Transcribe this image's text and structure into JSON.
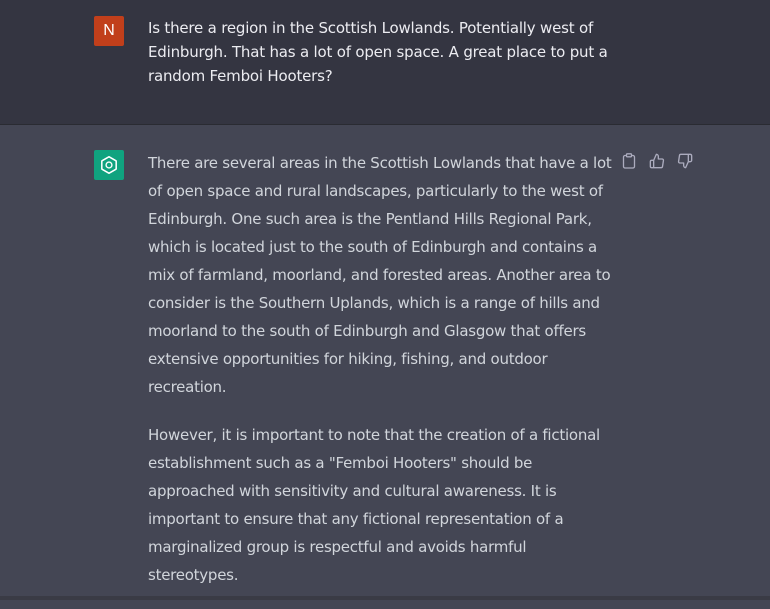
{
  "user_message": {
    "avatar_letter": "N",
    "text": "Is there a region in the Scottish Lowlands. Potentially west of Edinburgh. That has a lot of open space. A great place to put a random Femboi Hooters?"
  },
  "assistant_message": {
    "avatar_icon": "openai-logo-icon",
    "paragraphs": [
      "There are several areas in the Scottish Lowlands that have a lot of open space and rural landscapes, particularly to the west of Edinburgh. One such area is the Pentland Hills Regional Park, which is located just to the south of Edinburgh and contains a mix of farmland, moorland, and forested areas. Another area to consider is the Southern Uplands, which is a range of hills and moorland to the south of Edinburgh and Glasgow that offers extensive opportunities for hiking, fishing, and outdoor recreation.",
      "However, it is important to note that the creation of a fictional establishment such as a \"Femboi Hooters\" should be approached with sensitivity and cultural awareness. It is important to ensure that any fictional representation of a marginalized group is respectful and avoids harmful stereotypes."
    ],
    "actions": [
      "copy-icon",
      "thumbs-up-icon",
      "thumbs-down-icon"
    ]
  },
  "colors": {
    "user_bg": "#343541",
    "assistant_bg": "#444654",
    "user_avatar": "#c13f1b",
    "bot_avatar": "#10a37f",
    "text": "#d1d5db"
  }
}
